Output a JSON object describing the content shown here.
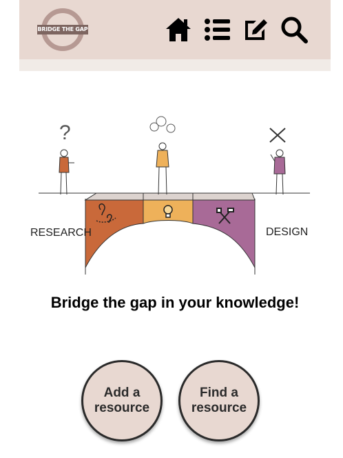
{
  "header": {
    "logo_text": "BRIDGE THE GAP",
    "nav": [
      {
        "icon": "home-icon"
      },
      {
        "icon": "list-icon"
      },
      {
        "icon": "edit-icon"
      },
      {
        "icon": "search-icon"
      }
    ]
  },
  "illustration": {
    "left_label": "RESEARCH",
    "right_label": "DESIGN"
  },
  "main": {
    "headline": "Bridge the gap in your knowledge!",
    "buttons": [
      {
        "line1": "Add a",
        "line2": "resource"
      },
      {
        "line1": "Find a",
        "line2": "resource"
      }
    ]
  },
  "colors": {
    "header_bg": "#e8d8d1",
    "bridge_left": "#c9693a",
    "bridge_middle": "#eeb15a",
    "bridge_right": "#a86a97",
    "button_bg": "#e8d8d1"
  }
}
